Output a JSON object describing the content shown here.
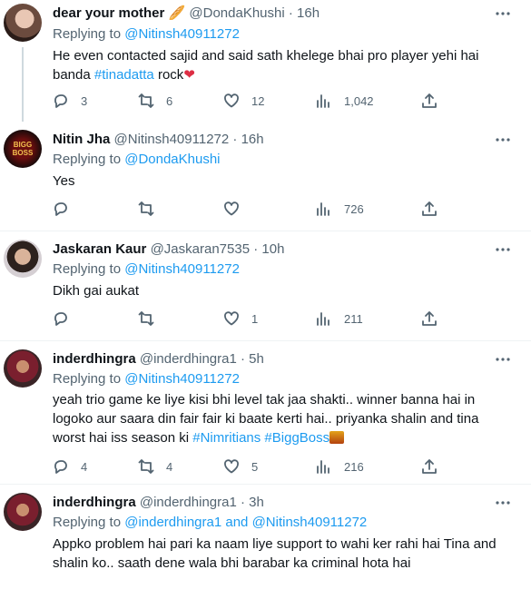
{
  "tweets": [
    {
      "name": "dear your mother",
      "name_emoji": "🥖",
      "handle": "@DondaKhushi",
      "dot": "·",
      "time": "16h",
      "replying_prefix": "Replying to",
      "replying_to": "@Nitinsh40911272",
      "body_pre": "He even contacted sajid and said sath khelege bhai pro player yehi hai banda",
      "hashtag": "#tinadatta",
      "body_post": " rock",
      "heart": "❤",
      "replies": "3",
      "retweets": "6",
      "likes": "12",
      "views": "1,042"
    },
    {
      "name": "Nitin Jha",
      "handle": "@Nitinsh40911272",
      "dot": "·",
      "time": "16h",
      "replying_prefix": "Replying to",
      "replying_to": "@DondaKhushi",
      "body": "Yes",
      "replies": "",
      "retweets": "",
      "likes": "",
      "views": "726",
      "avatar_text": "BIGG BOSS"
    },
    {
      "name": "Jaskaran Kaur",
      "handle": "@Jaskaran7535",
      "dot": "·",
      "time": "10h",
      "replying_prefix": "Replying to",
      "replying_to": "@Nitinsh40911272",
      "body": "Dikh gai aukat",
      "replies": "",
      "retweets": "",
      "likes": "1",
      "views": "211"
    },
    {
      "name": "inderdhingra",
      "handle": "@inderdhingra1",
      "dot": "·",
      "time": "5h",
      "replying_prefix": "Replying to",
      "replying_to": "@Nitinsh40911272",
      "body_line1": "yeah trio game ke liye kisi bhi level tak jaa shakti.. winner banna hai in",
      "body_line2": "logoko aur saara din fair fair ki baate kerti hai.. priyanka shalin and tina",
      "body_line3_pre": "worst hai iss season ki ",
      "hashtag1": "#Nimritians",
      "hashtag2": "#BiggBoss",
      "replies": "4",
      "retweets": "4",
      "likes": "5",
      "views": "216"
    },
    {
      "name": "inderdhingra",
      "handle": "@inderdhingra1",
      "dot": "·",
      "time": "3h",
      "replying_prefix": "Replying to",
      "replying_to_1": "@inderdhingra1",
      "replying_and": "and",
      "replying_to_2": "@Nitinsh40911272",
      "body_line1": "Appko problem hai pari ka naam liye support to wahi ker rahi hai Tina and",
      "body_line2": "shalin ko.. saath dene wala bhi barabar ka criminal hota hai"
    }
  ],
  "colors": {
    "accent": "#1d9bf0",
    "muted": "#536471",
    "text": "#0f1419",
    "separator": "#eff3f4"
  }
}
